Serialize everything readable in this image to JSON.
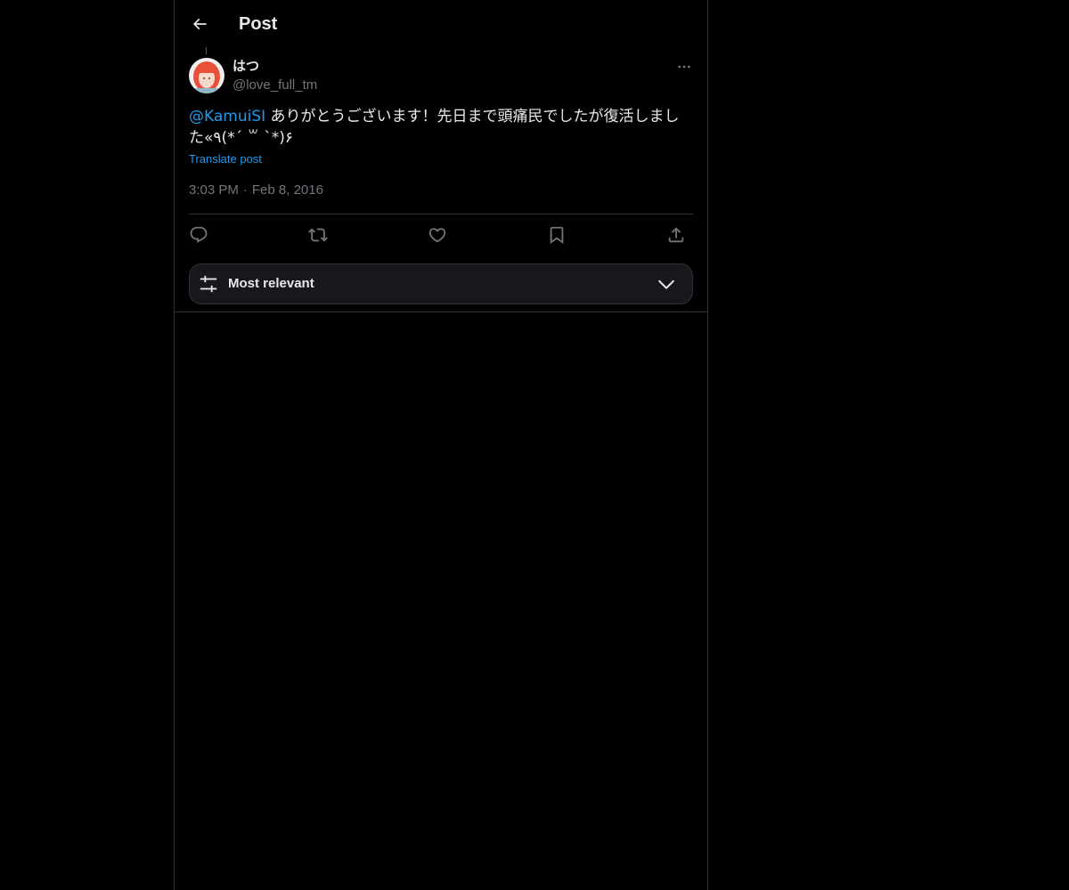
{
  "header": {
    "title": "Post",
    "back_icon": "arrow-left-icon"
  },
  "post": {
    "author": {
      "display_name": "はつ",
      "handle": "@love_full_tm",
      "avatar_icon": "avatar"
    },
    "mention": "@KamuiSI",
    "text": " ありがとうございます！先日まで頭痛民でしたが復活しました«٩(*´ ꒳ `*)۶",
    "translate_label": "Translate post",
    "time": "3:03 PM",
    "separator": "·",
    "date": "Feb 8, 2016",
    "actions": {
      "reply_icon": "reply-icon",
      "repost_icon": "repost-icon",
      "like_icon": "heart-icon",
      "bookmark_icon": "bookmark-icon",
      "share_icon": "share-icon"
    }
  },
  "replies_sort": {
    "label": "Most relevant",
    "icon": "sliders-icon",
    "chevron": "chevron-down-icon"
  },
  "colors": {
    "background": "#000000",
    "text": "#e7e9ea",
    "muted": "#71767b",
    "accent": "#1d9bf0",
    "border": "#2f3336",
    "sort_bg": "#16181c"
  }
}
